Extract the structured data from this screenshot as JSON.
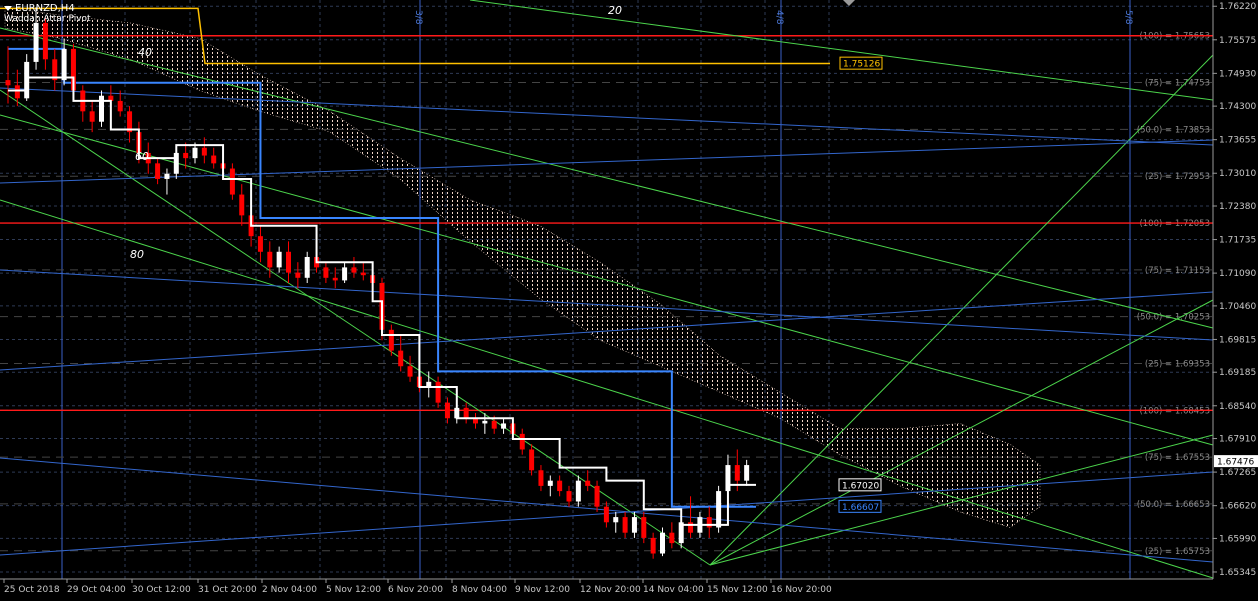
{
  "header": {
    "symbol": "EURNZD,H4",
    "indicator": "Waddah Attar Pivot"
  },
  "colors": {
    "background": "#000000",
    "grid": "#2e3a55",
    "candle_up": "#ffffff",
    "candle_down": "#ff0000",
    "white_line": "#ffffff",
    "blue_line": "#3a86ff",
    "red_level": "#ff1a1a",
    "gann_green": "#4cd44c",
    "fib_blue": "#3366cc",
    "cloud": "#f2d6c8",
    "yellow": "#ffc000",
    "vline": "#3a60c8"
  },
  "chart_data": {
    "type": "candlestick",
    "symbol": "EURNZD",
    "timeframe": "H4",
    "ylim": [
      1.6521,
      1.7634
    ],
    "price_ticks": [
      "1.76220",
      "1.75575",
      "1.74930",
      "1.74300",
      "1.73655",
      "1.73010",
      "1.72380",
      "1.71735",
      "1.71090",
      "1.70460",
      "1.69815",
      "1.69185",
      "1.68540",
      "1.67910",
      "1.67265",
      "1.66620",
      "1.65990",
      "1.65345"
    ],
    "date_ticks": [
      "25 Oct 2018",
      "29 Oct 04:00",
      "30 Oct 12:00",
      "31 Oct 20:00",
      "2 Nov 04:00",
      "5 Nov 12:00",
      "6 Nov 20:00",
      "8 Nov 04:00",
      "9 Nov 12:00",
      "12 Nov 20:00",
      "14 Nov 04:00",
      "15 Nov 12:00",
      "16 Nov 20:00"
    ],
    "current_price": "1.67476",
    "fib_levels": [
      {
        "label": "(100) = 1.75653",
        "value": 1.75653
      },
      {
        "label": "(75) = 1.74753",
        "value": 1.74753
      },
      {
        "label": "(50.0) = 1.73853",
        "value": 1.73853
      },
      {
        "label": "(25) = 1.72953",
        "value": 1.72953
      },
      {
        "label": "(100) = 1.72053",
        "value": 1.72053
      },
      {
        "label": "(75) = 1.71153",
        "value": 1.71153
      },
      {
        "label": "(50.0) = 1.70253",
        "value": 1.70253
      },
      {
        "label": "(25) = 1.69353",
        "value": 1.69353
      },
      {
        "label": "(100) = 1.68453",
        "value": 1.68453
      },
      {
        "label": "(75) = 1.67553",
        "value": 1.67553
      },
      {
        "label": "(50.0) = 1.66653",
        "value": 1.66653
      },
      {
        "label": "(25) = 1.65753",
        "value": 1.65753
      }
    ],
    "red_levels": [
      1.75653,
      1.72053,
      1.68453
    ],
    "price_boxes": [
      {
        "label": "1.75126",
        "value": 1.75126,
        "color": "#ffc000"
      },
      {
        "label": "1.67020",
        "value": 1.6702,
        "color": "#ffffff"
      },
      {
        "label": "1.66607",
        "value": 1.66607,
        "color": "#3a86ff"
      }
    ],
    "vline_labels": [
      "3/8",
      "4/8",
      "5/8"
    ],
    "chart_text": [
      "40",
      "60",
      "80",
      "20"
    ],
    "candles": [
      [
        1.748,
        1.7545,
        1.7435,
        1.747
      ],
      [
        1.747,
        1.75,
        1.743,
        1.7445
      ],
      [
        1.7445,
        1.753,
        1.744,
        1.7515
      ],
      [
        1.7515,
        1.762,
        1.75,
        1.759
      ],
      [
        1.759,
        1.76,
        1.75,
        1.752
      ],
      [
        1.752,
        1.754,
        1.746,
        1.748
      ],
      [
        1.748,
        1.756,
        1.747,
        1.754
      ],
      [
        1.754,
        1.755,
        1.744,
        1.746
      ],
      [
        1.746,
        1.747,
        1.74,
        1.742
      ],
      [
        1.742,
        1.744,
        1.738,
        1.74
      ],
      [
        1.74,
        1.746,
        1.739,
        1.745
      ],
      [
        1.745,
        1.747,
        1.742,
        1.744
      ],
      [
        1.744,
        1.746,
        1.741,
        1.742
      ],
      [
        1.742,
        1.743,
        1.736,
        1.738
      ],
      [
        1.738,
        1.74,
        1.732,
        1.734
      ],
      [
        1.734,
        1.736,
        1.73,
        1.732
      ],
      [
        1.732,
        1.733,
        1.728,
        1.729
      ],
      [
        1.729,
        1.731,
        1.726,
        1.73
      ],
      [
        1.73,
        1.735,
        1.729,
        1.734
      ],
      [
        1.734,
        1.736,
        1.731,
        1.733
      ],
      [
        1.733,
        1.736,
        1.732,
        1.735
      ],
      [
        1.735,
        1.737,
        1.732,
        1.7335
      ],
      [
        1.7335,
        1.735,
        1.731,
        1.732
      ],
      [
        1.732,
        1.734,
        1.73,
        1.731
      ],
      [
        1.731,
        1.732,
        1.725,
        1.726
      ],
      [
        1.726,
        1.728,
        1.72,
        1.722
      ],
      [
        1.722,
        1.724,
        1.716,
        1.718
      ],
      [
        1.718,
        1.72,
        1.713,
        1.715
      ],
      [
        1.715,
        1.717,
        1.71,
        1.712
      ],
      [
        1.712,
        1.716,
        1.711,
        1.715
      ],
      [
        1.715,
        1.717,
        1.709,
        1.711
      ],
      [
        1.711,
        1.713,
        1.708,
        1.71
      ],
      [
        1.71,
        1.715,
        1.709,
        1.714
      ],
      [
        1.714,
        1.716,
        1.711,
        1.712
      ],
      [
        1.712,
        1.713,
        1.709,
        1.71
      ],
      [
        1.71,
        1.712,
        1.708,
        1.7095
      ],
      [
        1.7095,
        1.713,
        1.709,
        1.712
      ],
      [
        1.712,
        1.714,
        1.71,
        1.711
      ],
      [
        1.711,
        1.713,
        1.7095,
        1.7105
      ],
      [
        1.7105,
        1.7115,
        1.708,
        1.709
      ],
      [
        1.709,
        1.71,
        1.698,
        1.7
      ],
      [
        1.7,
        1.701,
        1.695,
        1.696
      ],
      [
        1.696,
        1.699,
        1.692,
        1.693
      ],
      [
        1.693,
        1.695,
        1.69,
        1.691
      ],
      [
        1.691,
        1.693,
        1.688,
        1.689
      ],
      [
        1.689,
        1.692,
        1.687,
        1.69
      ],
      [
        1.69,
        1.691,
        1.685,
        1.686
      ],
      [
        1.686,
        1.687,
        1.682,
        1.683
      ],
      [
        1.683,
        1.686,
        1.682,
        1.685
      ],
      [
        1.685,
        1.686,
        1.682,
        1.683
      ],
      [
        1.683,
        1.684,
        1.681,
        1.682
      ],
      [
        1.682,
        1.684,
        1.68,
        1.6825
      ],
      [
        1.6825,
        1.6835,
        1.68,
        1.681
      ],
      [
        1.681,
        1.683,
        1.68,
        1.682
      ],
      [
        1.682,
        1.683,
        1.679,
        1.68
      ],
      [
        1.68,
        1.681,
        1.676,
        1.677
      ],
      [
        1.677,
        1.678,
        1.672,
        1.673
      ],
      [
        1.673,
        1.674,
        1.669,
        1.67
      ],
      [
        1.67,
        1.672,
        1.668,
        1.671
      ],
      [
        1.671,
        1.672,
        1.668,
        1.669
      ],
      [
        1.669,
        1.67,
        1.666,
        1.667
      ],
      [
        1.667,
        1.672,
        1.666,
        1.671
      ],
      [
        1.671,
        1.673,
        1.669,
        1.67
      ],
      [
        1.67,
        1.671,
        1.665,
        1.666
      ],
      [
        1.666,
        1.667,
        1.662,
        1.663
      ],
      [
        1.663,
        1.665,
        1.661,
        1.664
      ],
      [
        1.664,
        1.665,
        1.66,
        1.661
      ],
      [
        1.661,
        1.665,
        1.66,
        1.664
      ],
      [
        1.664,
        1.665,
        1.659,
        1.66
      ],
      [
        1.66,
        1.661,
        1.656,
        1.657
      ],
      [
        1.657,
        1.662,
        1.6565,
        1.661
      ],
      [
        1.661,
        1.663,
        1.658,
        1.659
      ],
      [
        1.659,
        1.664,
        1.658,
        1.663
      ],
      [
        1.663,
        1.668,
        1.66,
        1.661
      ],
      [
        1.661,
        1.665,
        1.66,
        1.664
      ],
      [
        1.664,
        1.666,
        1.66,
        1.662
      ],
      [
        1.662,
        1.67,
        1.661,
        1.669
      ],
      [
        1.669,
        1.676,
        1.668,
        1.674
      ],
      [
        1.674,
        1.677,
        1.669,
        1.671
      ],
      [
        1.671,
        1.675,
        1.67,
        1.674
      ]
    ],
    "white_steps": [
      [
        0,
        1.746
      ],
      [
        2,
        1.7485
      ],
      [
        7,
        1.744
      ],
      [
        11,
        1.7385
      ],
      [
        14,
        1.733
      ],
      [
        18,
        1.7355
      ],
      [
        23,
        1.729
      ],
      [
        26,
        1.72
      ],
      [
        33,
        1.713
      ],
      [
        39,
        1.7055
      ],
      [
        40,
        1.699
      ],
      [
        44,
        1.689
      ],
      [
        48,
        1.683
      ],
      [
        54,
        1.679
      ],
      [
        59,
        1.6735
      ],
      [
        64,
        1.671
      ],
      [
        68,
        1.6655
      ],
      [
        72,
        1.6625
      ],
      [
        77,
        1.6702
      ],
      [
        80,
        1.6702
      ]
    ],
    "blue_steps": [
      [
        0,
        1.754
      ],
      [
        6,
        1.7475
      ],
      [
        27,
        1.7215
      ],
      [
        46,
        1.692
      ],
      [
        71,
        1.666
      ],
      [
        80,
        1.666
      ]
    ]
  }
}
